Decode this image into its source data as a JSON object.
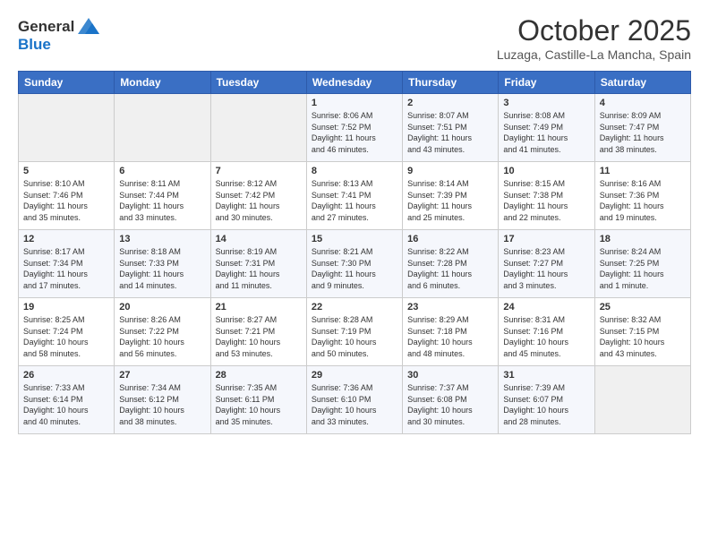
{
  "logo": {
    "line1": "General",
    "line2": "Blue"
  },
  "header": {
    "month": "October 2025",
    "location": "Luzaga, Castille-La Mancha, Spain"
  },
  "weekdays": [
    "Sunday",
    "Monday",
    "Tuesday",
    "Wednesday",
    "Thursday",
    "Friday",
    "Saturday"
  ],
  "weeks": [
    [
      {
        "day": "",
        "info": ""
      },
      {
        "day": "",
        "info": ""
      },
      {
        "day": "",
        "info": ""
      },
      {
        "day": "1",
        "info": "Sunrise: 8:06 AM\nSunset: 7:52 PM\nDaylight: 11 hours\nand 46 minutes."
      },
      {
        "day": "2",
        "info": "Sunrise: 8:07 AM\nSunset: 7:51 PM\nDaylight: 11 hours\nand 43 minutes."
      },
      {
        "day": "3",
        "info": "Sunrise: 8:08 AM\nSunset: 7:49 PM\nDaylight: 11 hours\nand 41 minutes."
      },
      {
        "day": "4",
        "info": "Sunrise: 8:09 AM\nSunset: 7:47 PM\nDaylight: 11 hours\nand 38 minutes."
      }
    ],
    [
      {
        "day": "5",
        "info": "Sunrise: 8:10 AM\nSunset: 7:46 PM\nDaylight: 11 hours\nand 35 minutes."
      },
      {
        "day": "6",
        "info": "Sunrise: 8:11 AM\nSunset: 7:44 PM\nDaylight: 11 hours\nand 33 minutes."
      },
      {
        "day": "7",
        "info": "Sunrise: 8:12 AM\nSunset: 7:42 PM\nDaylight: 11 hours\nand 30 minutes."
      },
      {
        "day": "8",
        "info": "Sunrise: 8:13 AM\nSunset: 7:41 PM\nDaylight: 11 hours\nand 27 minutes."
      },
      {
        "day": "9",
        "info": "Sunrise: 8:14 AM\nSunset: 7:39 PM\nDaylight: 11 hours\nand 25 minutes."
      },
      {
        "day": "10",
        "info": "Sunrise: 8:15 AM\nSunset: 7:38 PM\nDaylight: 11 hours\nand 22 minutes."
      },
      {
        "day": "11",
        "info": "Sunrise: 8:16 AM\nSunset: 7:36 PM\nDaylight: 11 hours\nand 19 minutes."
      }
    ],
    [
      {
        "day": "12",
        "info": "Sunrise: 8:17 AM\nSunset: 7:34 PM\nDaylight: 11 hours\nand 17 minutes."
      },
      {
        "day": "13",
        "info": "Sunrise: 8:18 AM\nSunset: 7:33 PM\nDaylight: 11 hours\nand 14 minutes."
      },
      {
        "day": "14",
        "info": "Sunrise: 8:19 AM\nSunset: 7:31 PM\nDaylight: 11 hours\nand 11 minutes."
      },
      {
        "day": "15",
        "info": "Sunrise: 8:21 AM\nSunset: 7:30 PM\nDaylight: 11 hours\nand 9 minutes."
      },
      {
        "day": "16",
        "info": "Sunrise: 8:22 AM\nSunset: 7:28 PM\nDaylight: 11 hours\nand 6 minutes."
      },
      {
        "day": "17",
        "info": "Sunrise: 8:23 AM\nSunset: 7:27 PM\nDaylight: 11 hours\nand 3 minutes."
      },
      {
        "day": "18",
        "info": "Sunrise: 8:24 AM\nSunset: 7:25 PM\nDaylight: 11 hours\nand 1 minute."
      }
    ],
    [
      {
        "day": "19",
        "info": "Sunrise: 8:25 AM\nSunset: 7:24 PM\nDaylight: 10 hours\nand 58 minutes."
      },
      {
        "day": "20",
        "info": "Sunrise: 8:26 AM\nSunset: 7:22 PM\nDaylight: 10 hours\nand 56 minutes."
      },
      {
        "day": "21",
        "info": "Sunrise: 8:27 AM\nSunset: 7:21 PM\nDaylight: 10 hours\nand 53 minutes."
      },
      {
        "day": "22",
        "info": "Sunrise: 8:28 AM\nSunset: 7:19 PM\nDaylight: 10 hours\nand 50 minutes."
      },
      {
        "day": "23",
        "info": "Sunrise: 8:29 AM\nSunset: 7:18 PM\nDaylight: 10 hours\nand 48 minutes."
      },
      {
        "day": "24",
        "info": "Sunrise: 8:31 AM\nSunset: 7:16 PM\nDaylight: 10 hours\nand 45 minutes."
      },
      {
        "day": "25",
        "info": "Sunrise: 8:32 AM\nSunset: 7:15 PM\nDaylight: 10 hours\nand 43 minutes."
      }
    ],
    [
      {
        "day": "26",
        "info": "Sunrise: 7:33 AM\nSunset: 6:14 PM\nDaylight: 10 hours\nand 40 minutes."
      },
      {
        "day": "27",
        "info": "Sunrise: 7:34 AM\nSunset: 6:12 PM\nDaylight: 10 hours\nand 38 minutes."
      },
      {
        "day": "28",
        "info": "Sunrise: 7:35 AM\nSunset: 6:11 PM\nDaylight: 10 hours\nand 35 minutes."
      },
      {
        "day": "29",
        "info": "Sunrise: 7:36 AM\nSunset: 6:10 PM\nDaylight: 10 hours\nand 33 minutes."
      },
      {
        "day": "30",
        "info": "Sunrise: 7:37 AM\nSunset: 6:08 PM\nDaylight: 10 hours\nand 30 minutes."
      },
      {
        "day": "31",
        "info": "Sunrise: 7:39 AM\nSunset: 6:07 PM\nDaylight: 10 hours\nand 28 minutes."
      },
      {
        "day": "",
        "info": ""
      }
    ]
  ]
}
